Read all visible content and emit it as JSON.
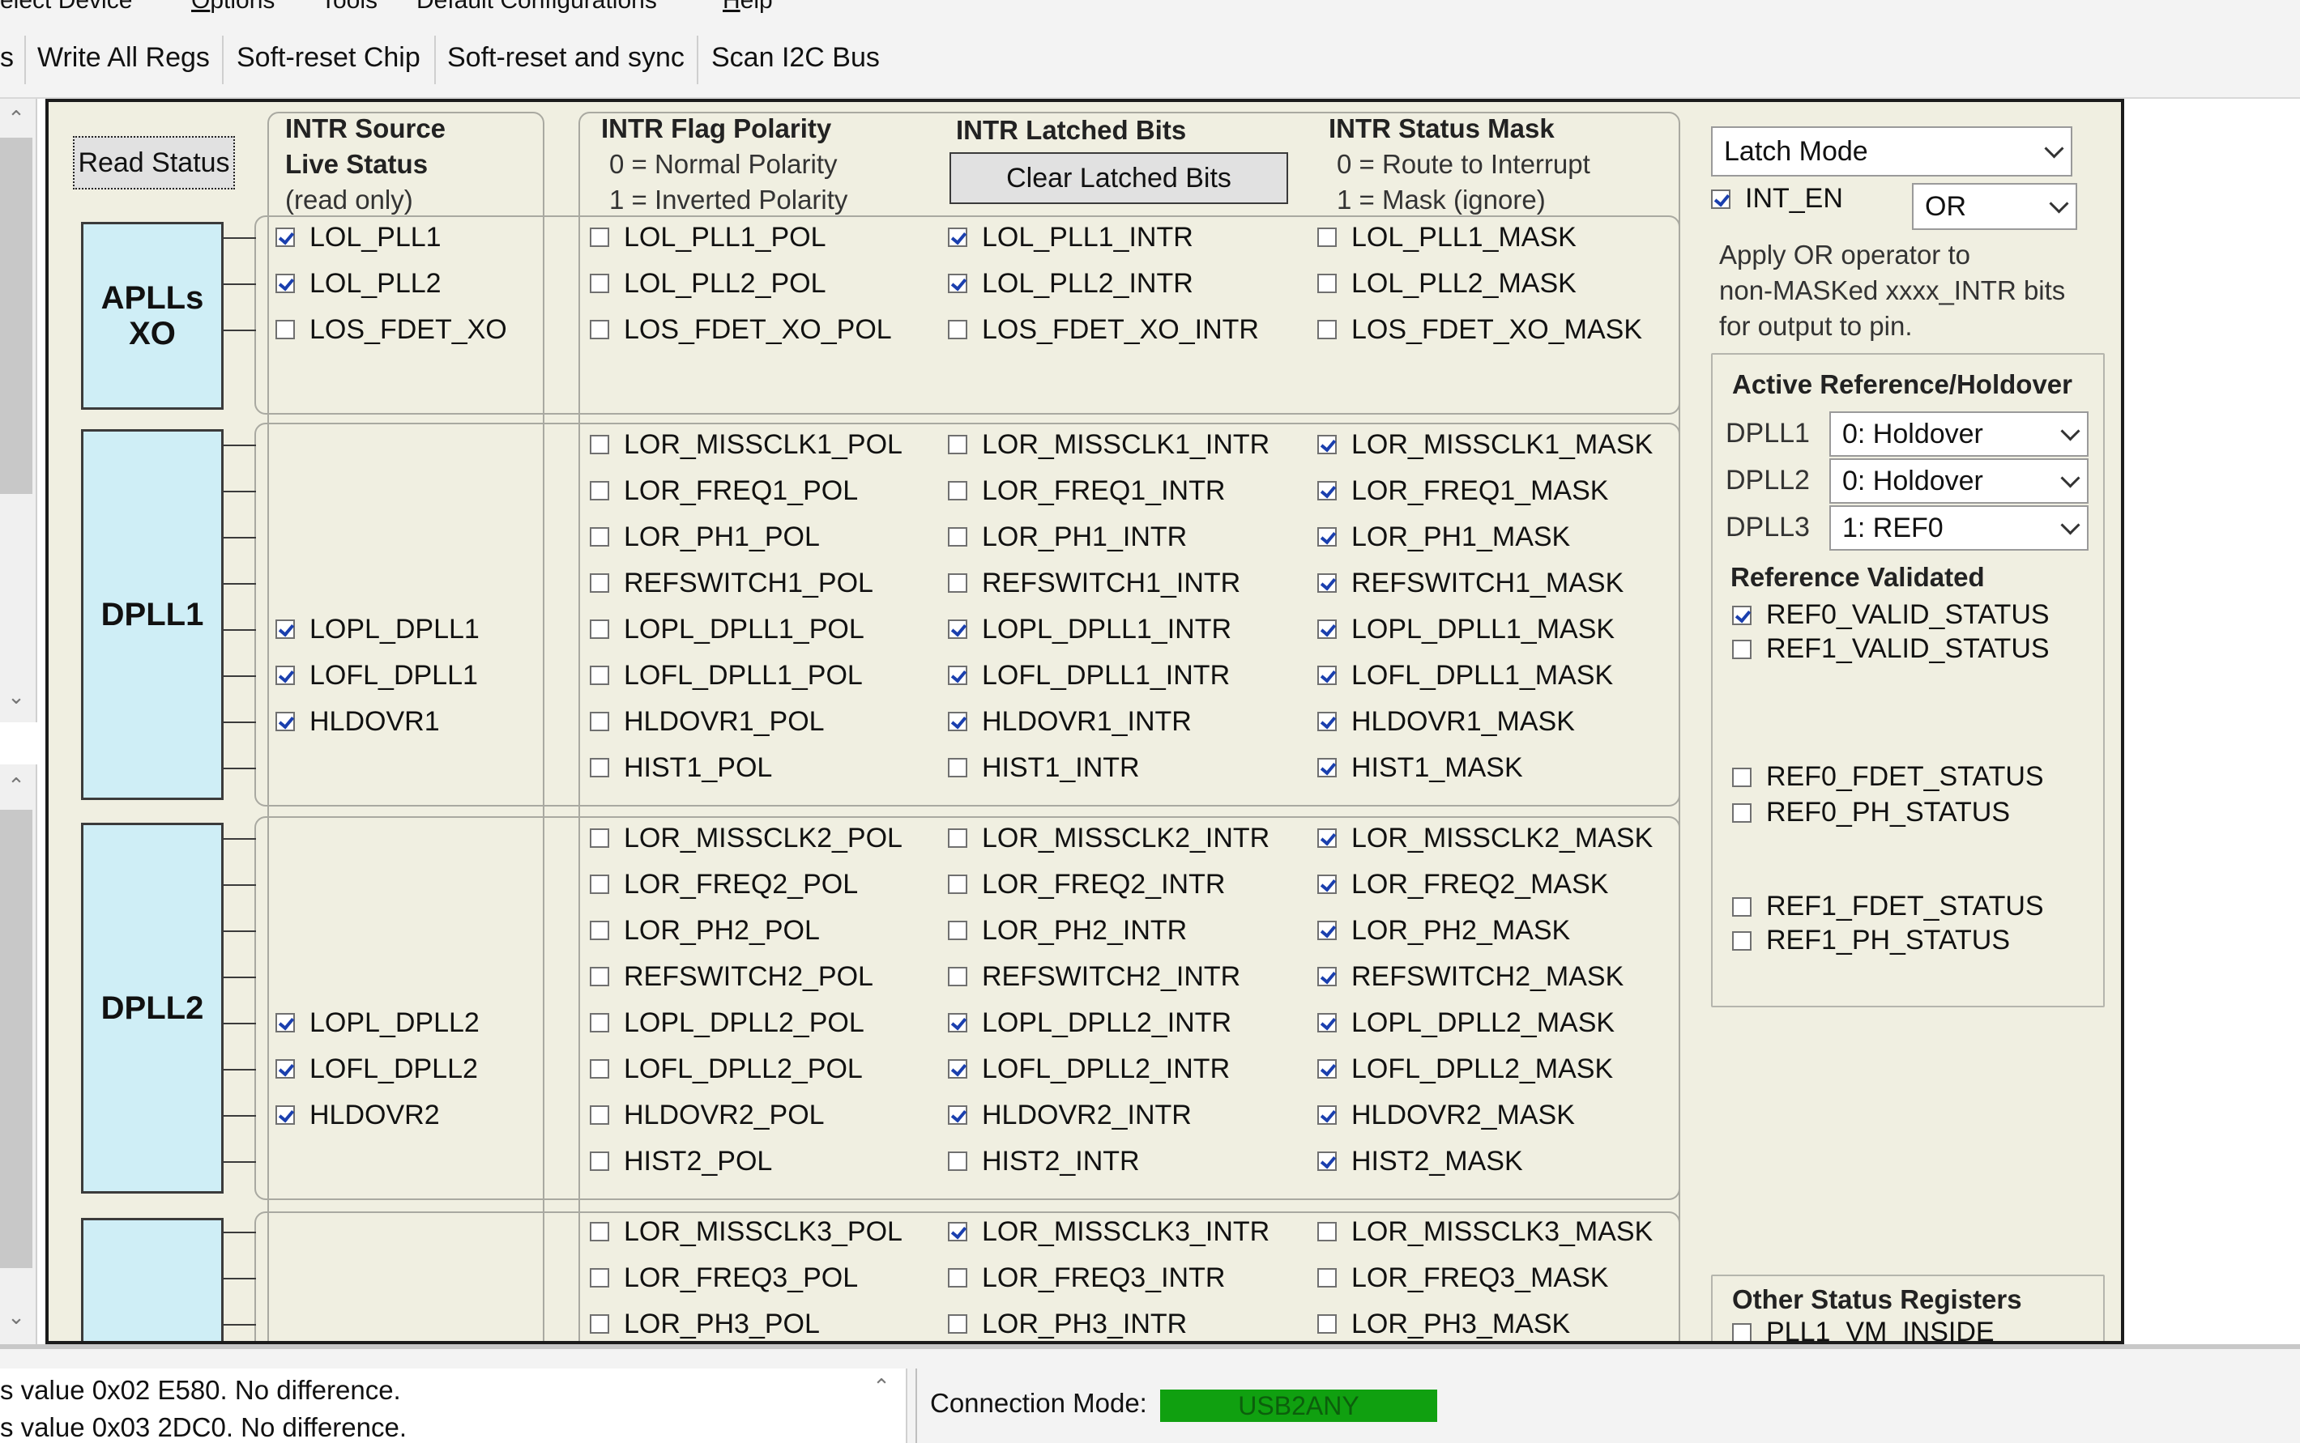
{
  "menu": {
    "items": [
      {
        "text": "elect Device",
        "u": ""
      },
      {
        "text": "Options",
        "u": "O"
      },
      {
        "text": "Tools",
        "u": ""
      },
      {
        "text": "Default Configurations",
        "u": ""
      },
      {
        "text": "Help",
        "u": "H"
      }
    ]
  },
  "toolbar": {
    "cut_label": "s",
    "write_all": "Write All Regs",
    "soft_reset_chip": "Soft-reset Chip",
    "soft_reset_sync": "Soft-reset and sync",
    "scan_i2c": "Scan I2C Bus"
  },
  "panel": {
    "read_status": "Read Status",
    "headers": {
      "src_title": "INTR Source",
      "src_live": "Live Status",
      "src_ro": "(read only)",
      "pol_title": "INTR Flag Polarity",
      "pol_0": "0 = Normal Polarity",
      "pol_1": "1 = Inverted Polarity",
      "latched_title": "INTR Latched Bits",
      "clear_latched": "Clear Latched Bits",
      "mask_title": "INTR Status Mask",
      "mask_0": "0 = Route to Interrupt",
      "mask_1": "1 = Mask (ignore)"
    },
    "blocks": {
      "aplls": "APLLs\nXO",
      "dpll1": "DPLL1",
      "dpll2": "DPLL2"
    },
    "rows": [
      {
        "src": "LOL_PLL1",
        "src_on": true,
        "pol": "LOL_PLL1_POL",
        "pol_on": false,
        "intr": "LOL_PLL1_INTR",
        "intr_on": true,
        "mask": "LOL_PLL1_MASK",
        "mask_on": false
      },
      {
        "src": "LOL_PLL2",
        "src_on": true,
        "pol": "LOL_PLL2_POL",
        "pol_on": false,
        "intr": "LOL_PLL2_INTR",
        "intr_on": true,
        "mask": "LOL_PLL2_MASK",
        "mask_on": false
      },
      {
        "src": "LOS_FDET_XO",
        "src_on": false,
        "pol": "LOS_FDET_XO_POL",
        "pol_on": false,
        "intr": "LOS_FDET_XO_INTR",
        "intr_on": false,
        "mask": "LOS_FDET_XO_MASK",
        "mask_on": false
      },
      {
        "src": "",
        "src_on": false,
        "pol": "LOR_MISSCLK1_POL",
        "pol_on": false,
        "intr": "LOR_MISSCLK1_INTR",
        "intr_on": false,
        "mask": "LOR_MISSCLK1_MASK",
        "mask_on": true
      },
      {
        "src": "",
        "src_on": false,
        "pol": "LOR_FREQ1_POL",
        "pol_on": false,
        "intr": "LOR_FREQ1_INTR",
        "intr_on": false,
        "mask": "LOR_FREQ1_MASK",
        "mask_on": true
      },
      {
        "src": "",
        "src_on": false,
        "pol": "LOR_PH1_POL",
        "pol_on": false,
        "intr": "LOR_PH1_INTR",
        "intr_on": false,
        "mask": "LOR_PH1_MASK",
        "mask_on": true
      },
      {
        "src": "",
        "src_on": false,
        "pol": "REFSWITCH1_POL",
        "pol_on": false,
        "intr": "REFSWITCH1_INTR",
        "intr_on": false,
        "mask": "REFSWITCH1_MASK",
        "mask_on": true
      },
      {
        "src": "LOPL_DPLL1",
        "src_on": true,
        "pol": "LOPL_DPLL1_POL",
        "pol_on": false,
        "intr": "LOPL_DPLL1_INTR",
        "intr_on": true,
        "mask": "LOPL_DPLL1_MASK",
        "mask_on": true
      },
      {
        "src": "LOFL_DPLL1",
        "src_on": true,
        "pol": "LOFL_DPLL1_POL",
        "pol_on": false,
        "intr": "LOFL_DPLL1_INTR",
        "intr_on": true,
        "mask": "LOFL_DPLL1_MASK",
        "mask_on": true
      },
      {
        "src": "HLDOVR1",
        "src_on": true,
        "pol": "HLDOVR1_POL",
        "pol_on": false,
        "intr": "HLDOVR1_INTR",
        "intr_on": true,
        "mask": "HLDOVR1_MASK",
        "mask_on": true
      },
      {
        "src": "",
        "src_on": false,
        "pol": "HIST1_POL",
        "pol_on": false,
        "intr": "HIST1_INTR",
        "intr_on": false,
        "mask": "HIST1_MASK",
        "mask_on": true
      },
      {
        "src": "",
        "src_on": false,
        "pol": "LOR_MISSCLK2_POL",
        "pol_on": false,
        "intr": "LOR_MISSCLK2_INTR",
        "intr_on": false,
        "mask": "LOR_MISSCLK2_MASK",
        "mask_on": true
      },
      {
        "src": "",
        "src_on": false,
        "pol": "LOR_FREQ2_POL",
        "pol_on": false,
        "intr": "LOR_FREQ2_INTR",
        "intr_on": false,
        "mask": "LOR_FREQ2_MASK",
        "mask_on": true
      },
      {
        "src": "",
        "src_on": false,
        "pol": "LOR_PH2_POL",
        "pol_on": false,
        "intr": "LOR_PH2_INTR",
        "intr_on": false,
        "mask": "LOR_PH2_MASK",
        "mask_on": true
      },
      {
        "src": "",
        "src_on": false,
        "pol": "REFSWITCH2_POL",
        "pol_on": false,
        "intr": "REFSWITCH2_INTR",
        "intr_on": false,
        "mask": "REFSWITCH2_MASK",
        "mask_on": true
      },
      {
        "src": "LOPL_DPLL2",
        "src_on": true,
        "pol": "LOPL_DPLL2_POL",
        "pol_on": false,
        "intr": "LOPL_DPLL2_INTR",
        "intr_on": true,
        "mask": "LOPL_DPLL2_MASK",
        "mask_on": true
      },
      {
        "src": "LOFL_DPLL2",
        "src_on": true,
        "pol": "LOFL_DPLL2_POL",
        "pol_on": false,
        "intr": "LOFL_DPLL2_INTR",
        "intr_on": true,
        "mask": "LOFL_DPLL2_MASK",
        "mask_on": true
      },
      {
        "src": "HLDOVR2",
        "src_on": true,
        "pol": "HLDOVR2_POL",
        "pol_on": false,
        "intr": "HLDOVR2_INTR",
        "intr_on": true,
        "mask": "HLDOVR2_MASK",
        "mask_on": true
      },
      {
        "src": "",
        "src_on": false,
        "pol": "HIST2_POL",
        "pol_on": false,
        "intr": "HIST2_INTR",
        "intr_on": false,
        "mask": "HIST2_MASK",
        "mask_on": true
      },
      {
        "src": "",
        "src_on": false,
        "pol": "LOR_MISSCLK3_POL",
        "pol_on": false,
        "intr": "LOR_MISSCLK3_INTR",
        "intr_on": true,
        "mask": "LOR_MISSCLK3_MASK",
        "mask_on": false
      },
      {
        "src": "",
        "src_on": false,
        "pol": "LOR_FREQ3_POL",
        "pol_on": false,
        "intr": "LOR_FREQ3_INTR",
        "intr_on": false,
        "mask": "LOR_FREQ3_MASK",
        "mask_on": false
      },
      {
        "src": "",
        "src_on": false,
        "pol": "LOR_PH3_POL",
        "pol_on": false,
        "intr": "LOR_PH3_INTR",
        "intr_on": false,
        "mask": "LOR_PH3_MASK",
        "mask_on": false
      }
    ]
  },
  "side": {
    "latch_mode": "Latch Mode",
    "int_en": "INT_EN",
    "int_en_on": true,
    "or_value": "OR",
    "apply_text_1": "Apply OR operator to",
    "apply_text_2": "non-MASKed xxxx_INTR bits",
    "apply_text_3": "for output to pin.",
    "active_ref_title": "Active Reference/Holdover",
    "dpll_labels": [
      "DPLL1",
      "DPLL2",
      "DPLL3"
    ],
    "dpll_values": [
      "0: Holdover",
      "0: Holdover",
      "1: REF0"
    ],
    "ref_validated_title": "Reference Validated",
    "status_items": [
      {
        "label": "REF0_VALID_STATUS",
        "on": true
      },
      {
        "label": "REF1_VALID_STATUS",
        "on": false
      },
      {
        "label": "REF0_FDET_STATUS",
        "on": false
      },
      {
        "label": "REF0_PH_STATUS",
        "on": false
      },
      {
        "label": "REF1_FDET_STATUS",
        "on": false
      },
      {
        "label": "REF1_PH_STATUS",
        "on": false
      }
    ],
    "other_status_title": "Other Status Registers",
    "pll1_vm": "PLL1_VM_INSIDE",
    "pll1_vm_on": false
  },
  "log": {
    "lines": [
      "s value 0x02 E580. No difference.",
      "s value 0x03 2DC0. No difference."
    ]
  },
  "status": {
    "connection_label": "Connection Mode:",
    "connection_value": "USB2ANY",
    "connection_color": "#10a010"
  }
}
